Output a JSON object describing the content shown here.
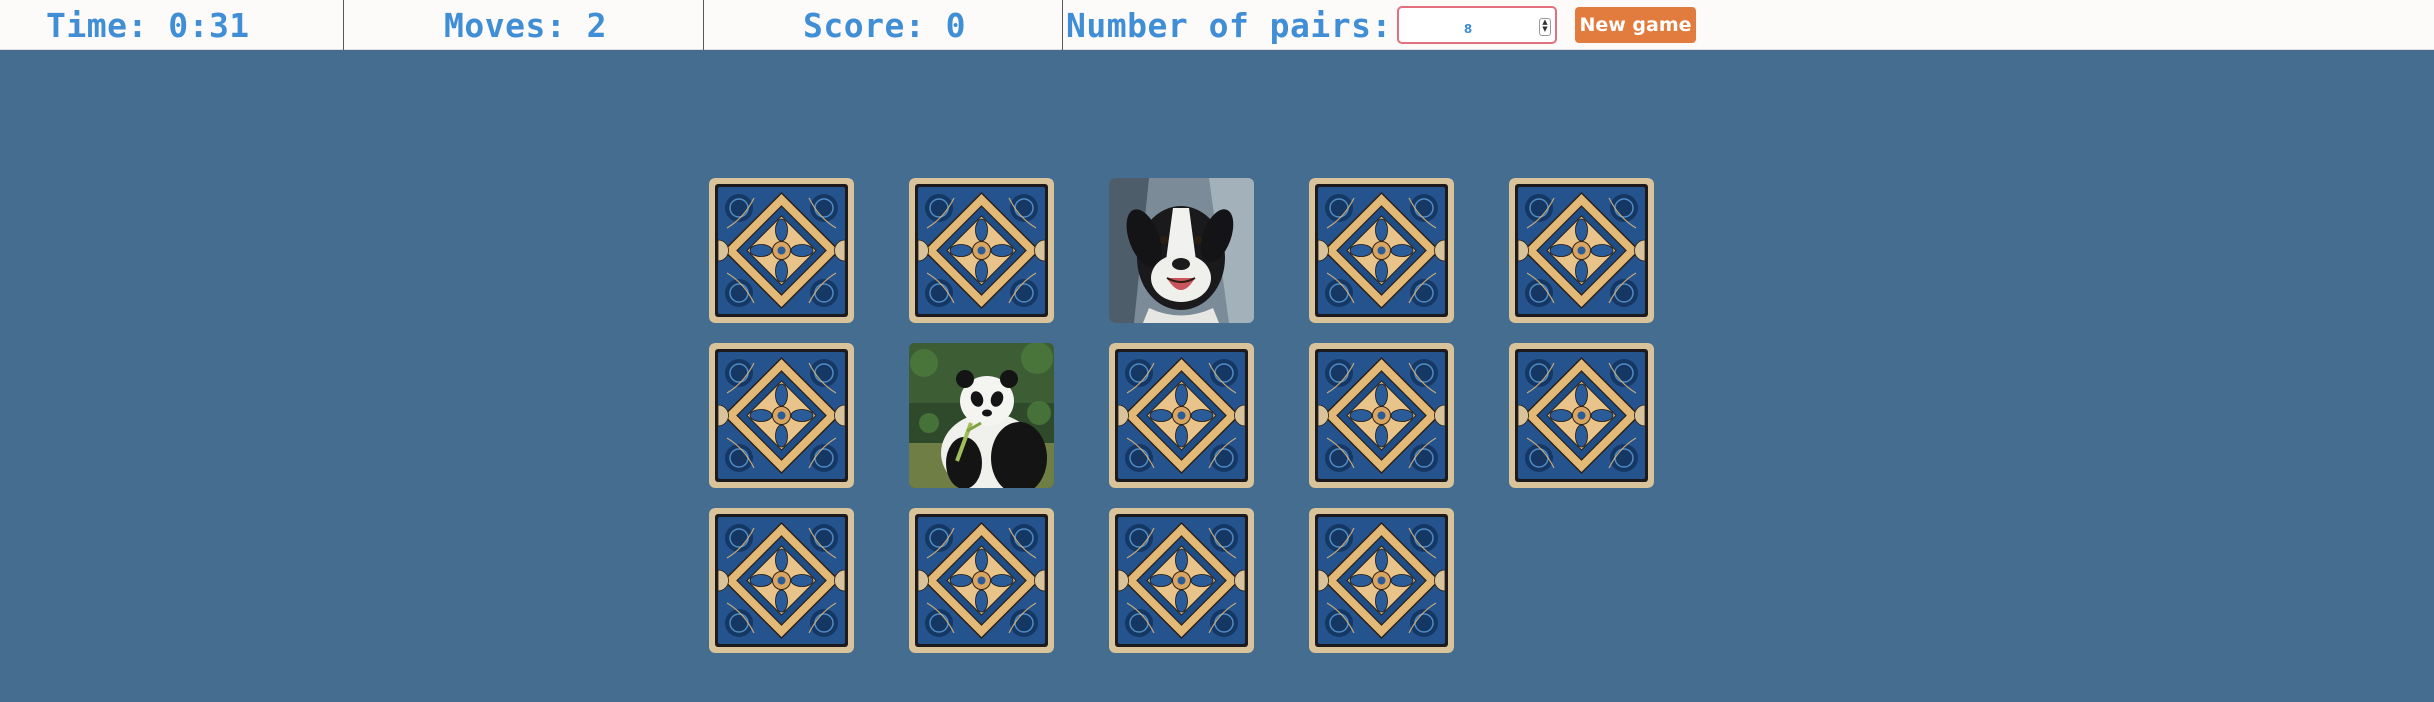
{
  "header": {
    "time": "Time: 0:31",
    "moves": "Moves: 2",
    "score": "Score: 0",
    "pairs_label": "Number of pairs:",
    "pairs_value": "8",
    "new_game_label": "New game"
  },
  "colors": {
    "background": "#456d8f",
    "stat_text": "#3f8ed6",
    "button": "#e27b3e",
    "card_frame": "#d8c39a",
    "card_blue": "#24538e"
  },
  "board": {
    "columns": 5,
    "cards": [
      {
        "state": "face-down"
      },
      {
        "state": "face-down"
      },
      {
        "state": "face-up",
        "image": "dog"
      },
      {
        "state": "face-down"
      },
      {
        "state": "face-down"
      },
      {
        "state": "face-down"
      },
      {
        "state": "face-up",
        "image": "panda"
      },
      {
        "state": "face-down"
      },
      {
        "state": "face-down"
      },
      {
        "state": "face-down"
      },
      {
        "state": "face-down"
      },
      {
        "state": "face-down"
      },
      {
        "state": "face-down"
      },
      {
        "state": "face-down"
      }
    ]
  }
}
